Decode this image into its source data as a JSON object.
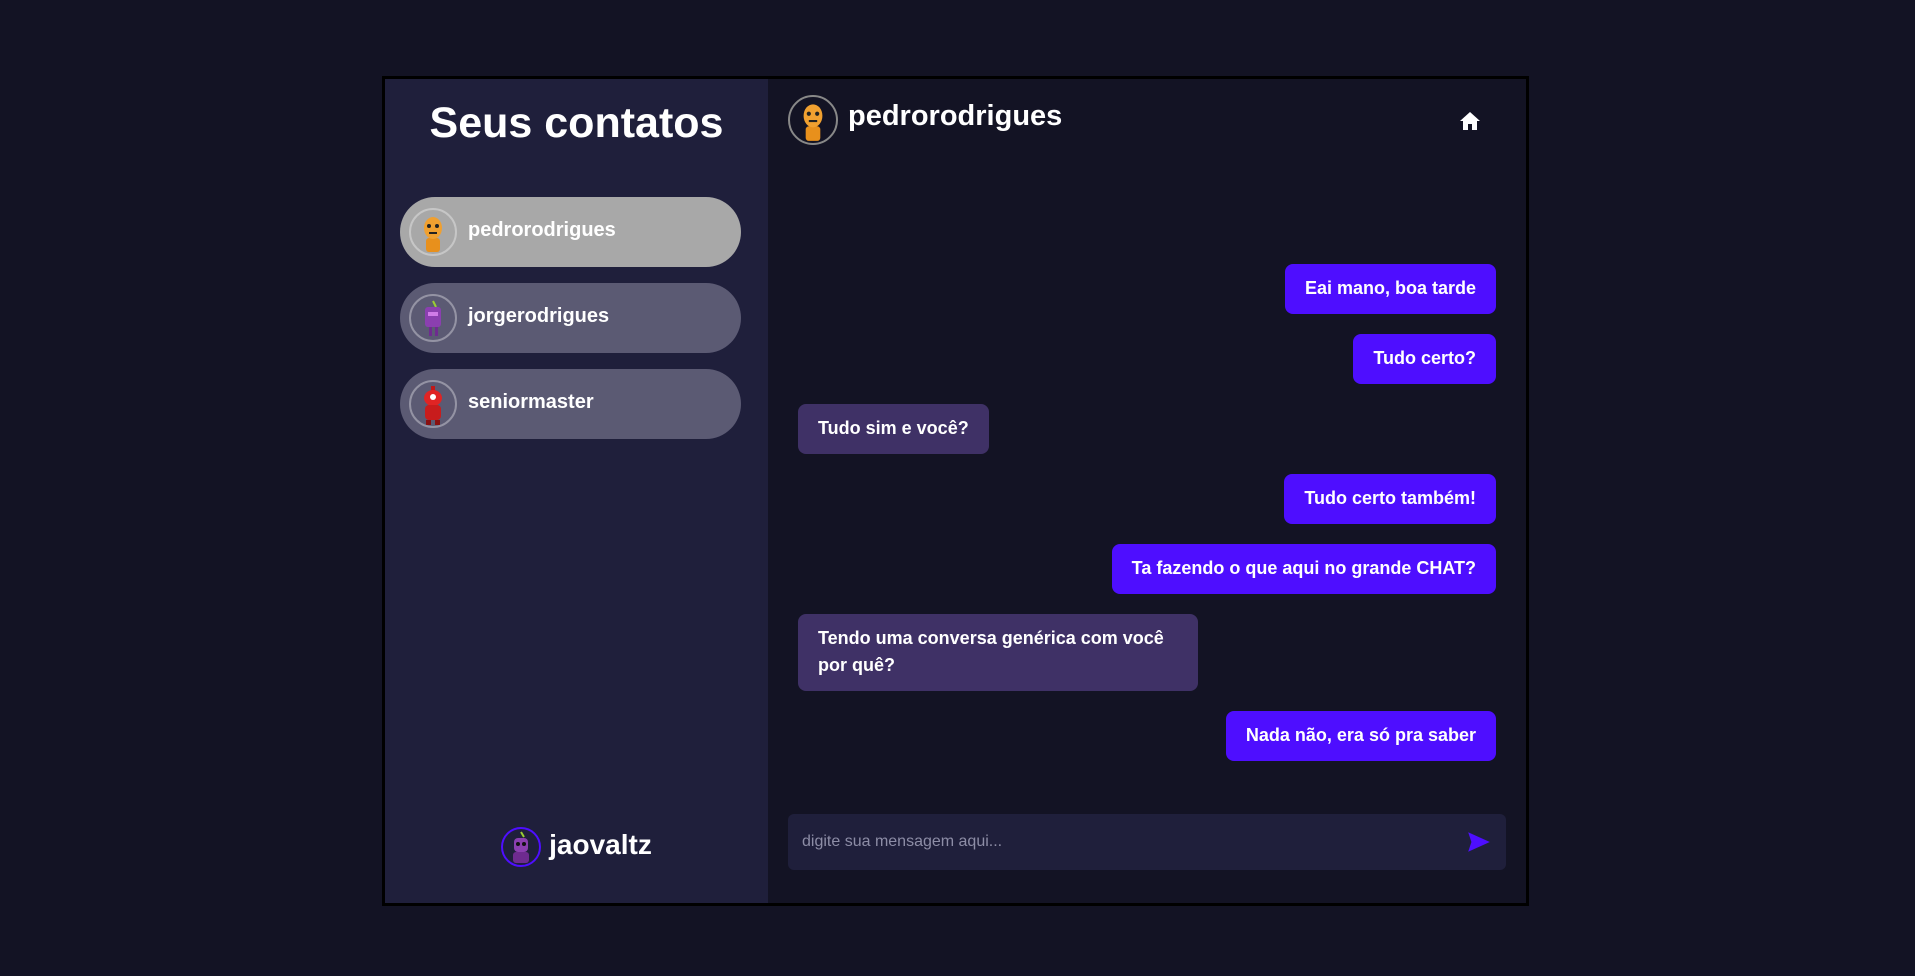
{
  "sidebar": {
    "title": "Seus contatos",
    "contacts": [
      {
        "name": "pedrorodrigues",
        "avatar": "orange-robot-avatar",
        "selected": true
      },
      {
        "name": "jorgerodrigues",
        "avatar": "purple-robot-avatar",
        "selected": false
      },
      {
        "name": "seniormaster",
        "avatar": "red-robot-avatar",
        "selected": false
      }
    ],
    "current_user": {
      "name": "jaovaltz",
      "avatar": "purple-robot-avatar"
    }
  },
  "chat": {
    "contact_name": "pedrorodrigues",
    "home_icon": "home-icon",
    "messages": [
      {
        "type": "sent",
        "text": "Eai mano, boa tarde"
      },
      {
        "type": "sent",
        "text": "Tudo certo?"
      },
      {
        "type": "received",
        "text": "Tudo sim e você?"
      },
      {
        "type": "sent",
        "text": "Tudo certo também!"
      },
      {
        "type": "sent",
        "text": "Ta fazendo o que aqui no grande CHAT?"
      },
      {
        "type": "received",
        "text": "Tendo uma conversa genérica com você por quê?"
      },
      {
        "type": "sent",
        "text": "Nada não, era só pra saber"
      }
    ],
    "input": {
      "placeholder": "digite sua mensagem aqui...",
      "value": ""
    },
    "send_icon": "send-icon"
  },
  "colors": {
    "background": "#131324",
    "sidebar": "#1f1f3b",
    "contact": "#5b5a73",
    "contact_selected": "#a8a8a8",
    "sent_bubble": "#4e0eff",
    "received_bubble": "#3f3166",
    "accent": "#4e0eff"
  }
}
